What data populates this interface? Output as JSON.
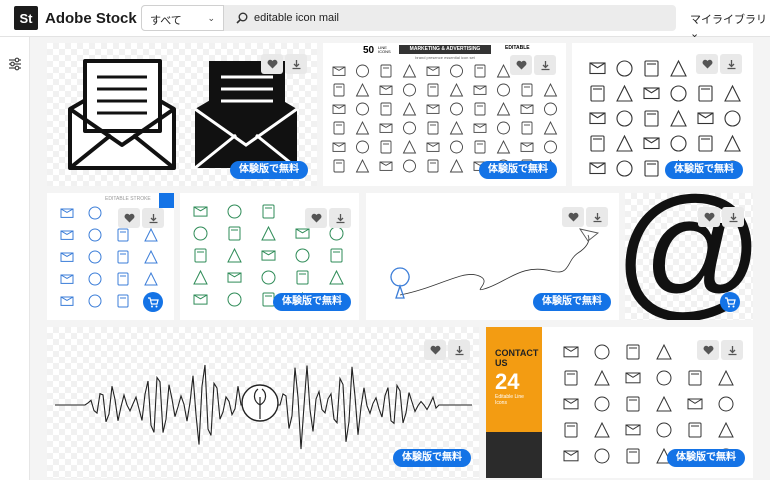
{
  "header": {
    "logo_badge": "St",
    "logo_text": "Adobe Stock",
    "scope": "すべて",
    "search_value": "editable icon mail",
    "library": "マイライブラリ"
  },
  "tile2": {
    "count": "50",
    "line_label": "LINE\nICONS",
    "banner": "MARKETING & ADVERTISING",
    "sub": "brand presence essential icon set",
    "editable": "EDITABLE"
  },
  "tile4": {
    "editable": "EDITABLE STROKE"
  },
  "tile9": {
    "title": "CONTACT US",
    "count": "24",
    "sub": "Editable Line Icons"
  },
  "trial_label": "体験版で無料",
  "colors": {
    "accent": "#1473e6",
    "orange": "#f39c12"
  },
  "icons": [
    "filter-icon",
    "search-icon",
    "heart-icon",
    "download-icon",
    "cart-icon"
  ]
}
